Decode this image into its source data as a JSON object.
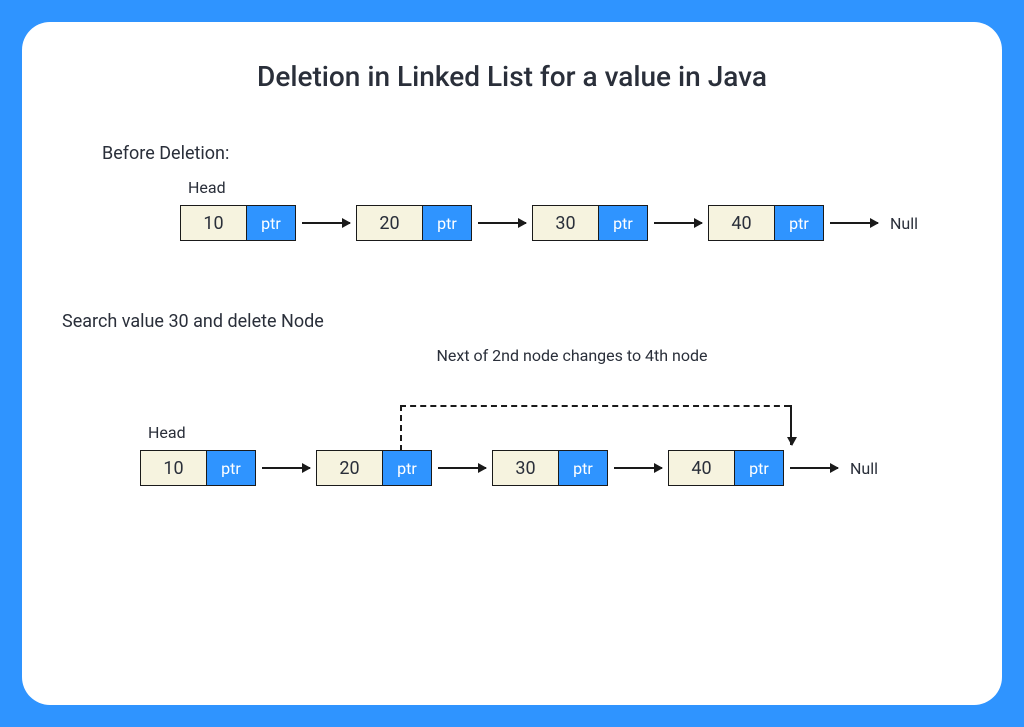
{
  "title": "Deletion in Linked List for a value in Java",
  "before": {
    "label": "Before Deletion:",
    "head_label": "Head",
    "nodes": [
      {
        "value": "10",
        "ptr": "ptr"
      },
      {
        "value": "20",
        "ptr": "ptr"
      },
      {
        "value": "30",
        "ptr": "ptr"
      },
      {
        "value": "40",
        "ptr": "ptr"
      }
    ],
    "null_label": "Null"
  },
  "after": {
    "label": "Search value 30 and delete Node",
    "caption": "Next of 2nd  node changes to 4th node",
    "head_label": "Head",
    "nodes": [
      {
        "value": "10",
        "ptr": "ptr"
      },
      {
        "value": "20",
        "ptr": "ptr"
      },
      {
        "value": "30",
        "ptr": "ptr"
      },
      {
        "value": "40",
        "ptr": "ptr"
      }
    ],
    "null_label": "Null"
  },
  "colors": {
    "frame": "#2f94ff",
    "node_value_bg": "#f6f3df",
    "node_ptr_bg": "#2f94ff"
  }
}
